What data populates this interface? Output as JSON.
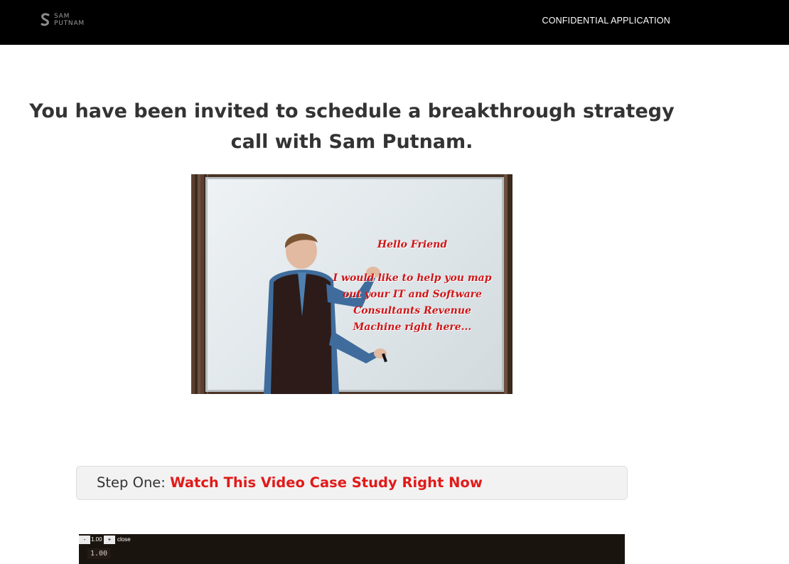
{
  "header": {
    "logo": {
      "line1": "SAM",
      "line2": "PUTNAM",
      "icon": "s-logo-icon"
    },
    "nav_link": "CONFIDENTIAL APPLICATION"
  },
  "headline": "You have been invited to schedule a breakthrough strategy call with Sam Putnam.",
  "hero_image": {
    "board_lines": [
      "Hello Friend",
      "I would like to help you map",
      "out your IT and Software",
      "Consultants Revenue",
      "Machine right here..."
    ]
  },
  "step": {
    "prefix": "Step One:",
    "highlight": "Watch This Video Case Study Right Now",
    "accent_color": "#e11a1a"
  },
  "video_controls": {
    "minus_label": "-",
    "rate_label": "1.00",
    "plus_label": "+",
    "close_label": "close",
    "rate_display": "1.00"
  }
}
